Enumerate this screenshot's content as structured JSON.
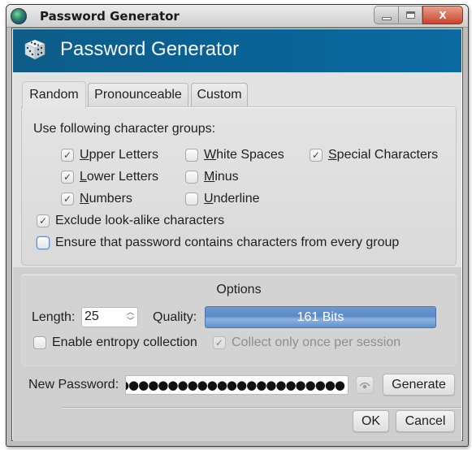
{
  "window": {
    "title": "Password Generator",
    "controls": {
      "minimize": "minimize",
      "maximize": "maximize",
      "close": "X"
    }
  },
  "banner": {
    "title": "Password Generator",
    "icon": "dice-icon"
  },
  "tabs": [
    {
      "label": "Random",
      "active": true
    },
    {
      "label": "Pronounceable",
      "active": false
    },
    {
      "label": "Custom",
      "active": false
    }
  ],
  "random": {
    "groups_label": "Use following character groups:",
    "groups": [
      {
        "label": "Upper Letters",
        "mnemonic": "U",
        "rest": "pper Letters",
        "checked": true
      },
      {
        "label": "Lower Letters",
        "mnemonic": "L",
        "rest": "ower Letters",
        "checked": true
      },
      {
        "label": "Numbers",
        "mnemonic": "N",
        "rest": "umbers",
        "checked": true
      },
      {
        "label": "White Spaces",
        "mnemonic": "W",
        "rest": "hite Spaces",
        "checked": false
      },
      {
        "label": "Minus",
        "mnemonic": "M",
        "rest": "inus",
        "checked": false
      },
      {
        "label": "Underline",
        "mnemonic": "U",
        "rest": "nderline",
        "checked": false
      },
      {
        "label": "Special Characters",
        "mnemonic": "S",
        "rest": "pecial Characters",
        "checked": true
      }
    ],
    "exclude_lookalike": {
      "label": "Exclude look-alike characters",
      "checked": true
    },
    "ensure_every_group": {
      "label": "Ensure that password contains characters from every group",
      "checked": false
    }
  },
  "options": {
    "title": "Options",
    "length_label": "Length:",
    "length_value": "25",
    "quality_label": "Quality:",
    "quality_text": "161 Bits",
    "quality_fill_fraction": 1.0,
    "entropy": {
      "label": "Enable entropy collection",
      "checked": false
    },
    "collect_once": {
      "label": "Collect only once per session",
      "checked": true,
      "disabled": true
    }
  },
  "new_password": {
    "label": "New Password:",
    "masked_value": "●●●●●●●●●●●●●●●●●●●●●●●●●",
    "reveal_icon": "eye-icon",
    "generate_label": "Generate"
  },
  "dialog_buttons": {
    "ok": "OK",
    "cancel": "Cancel"
  },
  "colors": {
    "banner": "#0b6399",
    "quality_bar": "#6a97d0",
    "close_button": "#c8432d"
  }
}
